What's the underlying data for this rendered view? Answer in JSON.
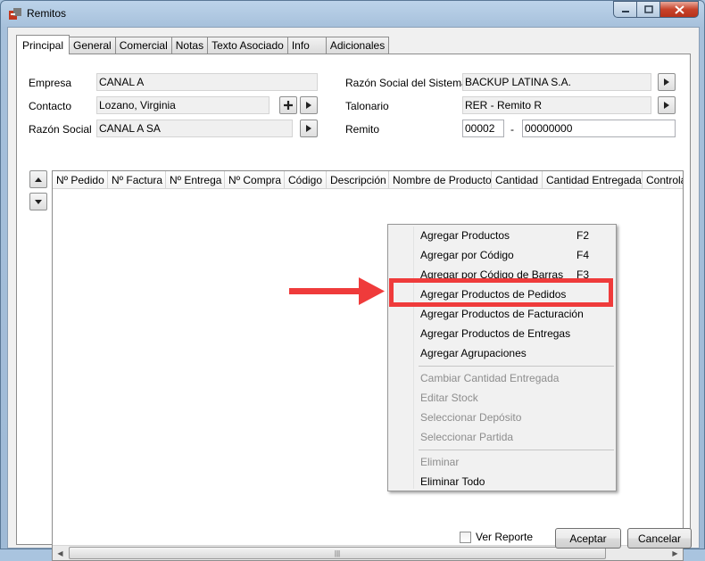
{
  "window": {
    "title": "Remitos"
  },
  "tabs": [
    "Principal",
    "General",
    "Comercial",
    "Notas",
    "Texto Asociado",
    "Info",
    "Adicionales"
  ],
  "form": {
    "empresa_label": "Empresa",
    "empresa_value": "CANAL A",
    "contacto_label": "Contacto",
    "contacto_value": "Lozano, Virginia",
    "razon_social_label": "Razón Social",
    "razon_social_value": "CANAL A SA",
    "razon_sistema_label": "Razón Social del Sistema",
    "razon_sistema_value": "BACKUP LATINA S.A.",
    "talonario_label": "Talonario",
    "talonario_value": "RER - Remito R",
    "remito_label": "Remito",
    "remito_prefix": "00002",
    "remito_separator": "-",
    "remito_number": "00000000"
  },
  "grid": {
    "columns": [
      "Nº Pedido",
      "Nº Factura",
      "Nº Entrega",
      "Nº Compra",
      "Código",
      "Descripción",
      "Nombre de Producto",
      "Cantidad",
      "Cantidad Entregada",
      "Controla"
    ]
  },
  "context_menu": {
    "items": [
      {
        "label": "Agregar Productos",
        "shortcut": "F2"
      },
      {
        "label": "Agregar por Código",
        "shortcut": "F4"
      },
      {
        "label": "Agregar por Código de Barras",
        "shortcut": "F3"
      },
      {
        "label": "Agregar Productos de Pedidos",
        "shortcut": ""
      },
      {
        "label": "Agregar Productos de Facturación",
        "shortcut": ""
      },
      {
        "label": "Agregar Productos de Entregas",
        "shortcut": ""
      },
      {
        "label": "Agregar Agrupaciones",
        "shortcut": ""
      },
      {
        "label": "Cambiar Cantidad Entregada",
        "shortcut": ""
      },
      {
        "label": "Editar Stock",
        "shortcut": ""
      },
      {
        "label": "Seleccionar Depósito",
        "shortcut": ""
      },
      {
        "label": "Seleccionar Partida",
        "shortcut": ""
      },
      {
        "label": "Eliminar",
        "shortcut": ""
      },
      {
        "label": "Eliminar Todo",
        "shortcut": ""
      }
    ],
    "disabled_items": [
      "Cambiar Cantidad Entregada",
      "Editar Stock",
      "Seleccionar Depósito",
      "Seleccionar Partida",
      "Eliminar"
    ],
    "highlighted_item": "Agregar Productos de Pedidos"
  },
  "footer": {
    "ver_reporte_label": "Ver Reporte",
    "ver_reporte_checked": false,
    "aceptar_label": "Aceptar",
    "cancelar_label": "Cancelar"
  },
  "colors": {
    "highlight": "#ef3b3b",
    "arrow": "#ef3b3b"
  }
}
